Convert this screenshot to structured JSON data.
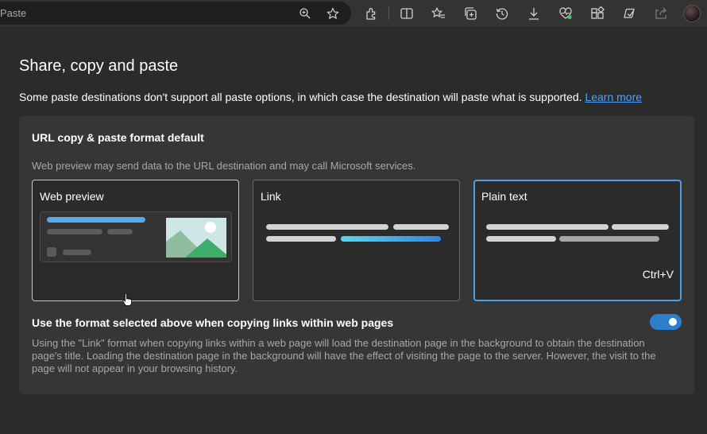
{
  "toolbar": {
    "address_text": "Paste",
    "icons": [
      "zoom-icon",
      "favorite-star-icon",
      "extensions-icon",
      "split-screen-icon",
      "favorites-icon",
      "collections-icon",
      "history-icon",
      "downloads-icon",
      "browser-essentials-icon",
      "apps-icon",
      "copilot-icon",
      "share-icon",
      "profile-avatar"
    ]
  },
  "page": {
    "title": "Share, copy and paste",
    "description": "Some paste destinations don't support all paste options, in which case the destination will paste what is supported.",
    "learn_more": "Learn more"
  },
  "url_format": {
    "title": "URL copy & paste format default",
    "subtitle": "Web preview may send data to the URL destination and may call Microsoft services.",
    "options": [
      {
        "label": "Web preview",
        "state": "hovered"
      },
      {
        "label": "Link",
        "state": "default"
      },
      {
        "label": "Plain text",
        "state": "selected",
        "shortcut": "Ctrl+V"
      }
    ]
  },
  "within_pages": {
    "title": "Use the format selected above when copying links within web pages",
    "description": "Using the \"Link\" format when copying links within a web page will load the destination page in the background to obtain the destination page's title. Loading the destination page in the background will have the effect of visiting the page to the server. However, the visit to the page will not appear in your browsing history.",
    "toggle_on": true
  },
  "colors": {
    "background": "#2b2b2b",
    "panel": "#363636",
    "accent": "#4aa0e6",
    "link": "#4da3ff",
    "toggle": "#2d7fcd"
  }
}
